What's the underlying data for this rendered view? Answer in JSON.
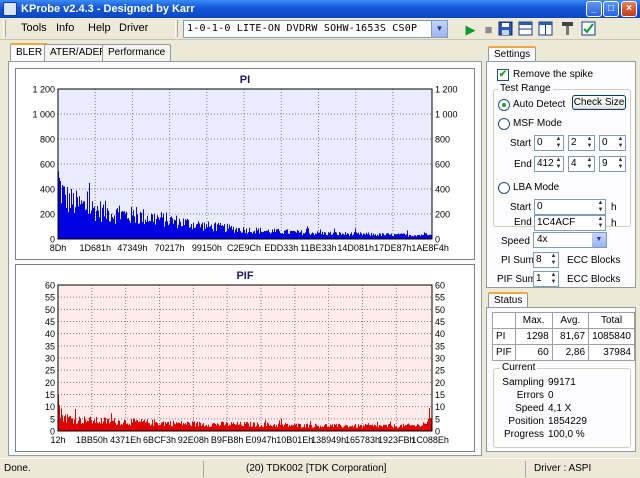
{
  "window": {
    "title": "KProbe v2.4.3 - Designed by Karr"
  },
  "menu": {
    "items": [
      "Tools",
      "Info",
      "Help",
      "Driver"
    ]
  },
  "drive": {
    "selected": "1-0-1-0 LITE-ON DVDRW SOHW-1653S CS0P"
  },
  "toolbar": {
    "icons": [
      "play-icon",
      "stop-icon",
      "save-icon",
      "layout-icon",
      "window-icon",
      "tools-icon",
      "checkbox-icon"
    ]
  },
  "tabs": [
    "BLER",
    "ATER/ADER",
    "Performance"
  ],
  "settings": {
    "tab_label": "Settings",
    "remove_spike_label": "Remove the spike",
    "remove_spike_checked": true,
    "test_range_label": "Test Range",
    "auto_detect_label": "Auto Detect",
    "check_size_label": "Check Size",
    "msf_mode_label": "MSF Mode",
    "start_label": "Start",
    "end_label": "End",
    "msf_start": [
      "0",
      "2",
      "0"
    ],
    "msf_end": [
      "412",
      "4",
      "9"
    ],
    "lba_mode_label": "LBA Mode",
    "lba_start": "0",
    "lba_end": "1C4ACF",
    "h_suffix": "h",
    "speed_label": "Speed",
    "speed_value": "4x",
    "pi_sum_label": "PI Sum",
    "pi_sum_value": "8",
    "pif_sum_label": "PIF Sum",
    "pif_sum_value": "1",
    "ecc_blocks_label": "ECC Blocks"
  },
  "status": {
    "tab_label": "Status",
    "headers": [
      "Max.",
      "Avg.",
      "Total"
    ],
    "rows": [
      {
        "label": "PI",
        "max": "1298",
        "avg": "81,67",
        "total": "1085840"
      },
      {
        "label": "PIF",
        "max": "60",
        "avg": "2,86",
        "total": "37984"
      }
    ],
    "current_label": "Current",
    "fields": [
      {
        "label": "Sampling",
        "value": "99171"
      },
      {
        "label": "Errors",
        "value": "0"
      },
      {
        "label": "Speed",
        "value": "4,1  X"
      },
      {
        "label": "Position",
        "value": "1854229"
      },
      {
        "label": "Progress",
        "value": "100,0 %"
      }
    ]
  },
  "statusbar": {
    "left": "Done.",
    "center": "(20) TDK002 [TDK Corporation]",
    "right": "Driver : ASPI"
  },
  "colors": {
    "pi_series": "#0000e0",
    "pif_series": "#e00000",
    "pi_bg": "#ebebff",
    "pif_bg": "#ffebeb",
    "grid": "#808080"
  },
  "chart_data": [
    {
      "type": "area",
      "title": "PI",
      "ylim": [
        0,
        1200
      ],
      "yticks": [
        "0",
        "200",
        "400",
        "600",
        "800",
        "1 000",
        "1 200"
      ],
      "xticks": [
        "8Dh",
        "1D681h",
        "47349h",
        "70217h",
        "99150h",
        "C2E9Ch",
        "EDD33h",
        "11BE33h",
        "14D081h",
        "17DE87h",
        "1AE8F4h"
      ],
      "profile": [
        [
          0.0,
          520
        ],
        [
          0.005,
          440
        ],
        [
          0.015,
          370
        ],
        [
          0.03,
          330
        ],
        [
          0.05,
          300
        ],
        [
          0.08,
          270
        ],
        [
          0.12,
          240
        ],
        [
          0.16,
          215
        ],
        [
          0.2,
          200
        ],
        [
          0.25,
          185
        ],
        [
          0.3,
          160
        ],
        [
          0.35,
          135
        ],
        [
          0.4,
          110
        ],
        [
          0.45,
          95
        ],
        [
          0.5,
          80
        ],
        [
          0.55,
          70
        ],
        [
          0.6,
          62
        ],
        [
          0.7,
          50
        ],
        [
          0.8,
          42
        ],
        [
          0.9,
          36
        ],
        [
          0.97,
          34
        ],
        [
          1.0,
          60
        ]
      ]
    },
    {
      "type": "area",
      "title": "PIF",
      "ylim": [
        0,
        60
      ],
      "yticks": [
        "0",
        "5",
        "10",
        "15",
        "20",
        "25",
        "30",
        "35",
        "40",
        "45",
        "50",
        "55",
        "60"
      ],
      "xticks": [
        "12h",
        "1BB50h",
        "4371Eh",
        "6BCF3h",
        "92E08h",
        "B9FB8h",
        "E0947h",
        "10B01Eh",
        "138949h",
        "165783h",
        "1923FBh",
        "1C088Eh"
      ],
      "profile": [
        [
          0.0,
          14
        ],
        [
          0.005,
          8
        ],
        [
          0.02,
          6
        ],
        [
          0.05,
          5
        ],
        [
          0.1,
          4.5
        ],
        [
          0.2,
          4
        ],
        [
          0.3,
          3.5
        ],
        [
          0.4,
          3
        ],
        [
          0.5,
          3
        ],
        [
          0.6,
          2.6
        ],
        [
          0.7,
          2.4
        ],
        [
          0.8,
          2.2
        ],
        [
          0.9,
          2.2
        ],
        [
          0.97,
          2.5
        ],
        [
          1.0,
          5
        ]
      ]
    }
  ]
}
